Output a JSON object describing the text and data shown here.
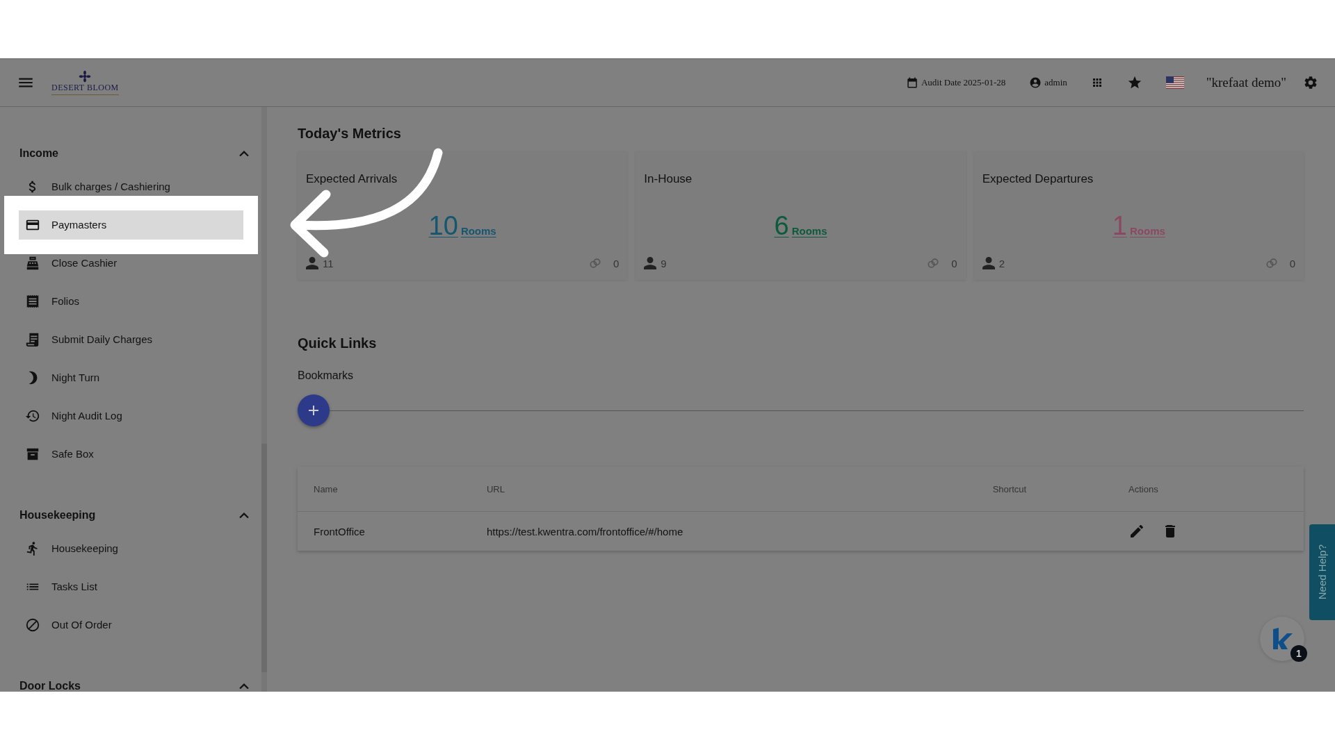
{
  "header": {
    "logo": "DESERT BLOOM",
    "audit_date": "Audit Date 2025-01-28",
    "user": "admin",
    "workspace": "\"krefaat demo\""
  },
  "sidebar": {
    "sections": [
      {
        "title": "Income",
        "expanded": true,
        "items": [
          {
            "label": "Bulk charges / Cashiering",
            "kind": "dollar",
            "selected": false
          },
          {
            "label": "Paymasters",
            "kind": "card",
            "selected": true
          },
          {
            "label": "Close Cashier",
            "kind": "register",
            "selected": false
          },
          {
            "label": "Folios",
            "kind": "receipt",
            "selected": false
          },
          {
            "label": "Submit Daily Charges",
            "kind": "document",
            "selected": false
          },
          {
            "label": "Night Turn",
            "kind": "moon",
            "selected": false
          },
          {
            "label": "Night Audit Log",
            "kind": "history",
            "selected": false
          },
          {
            "label": "Safe Box",
            "kind": "archive",
            "selected": false
          }
        ]
      },
      {
        "title": "Housekeeping",
        "expanded": true,
        "items": [
          {
            "label": "Housekeeping",
            "kind": "runner",
            "selected": false
          },
          {
            "label": "Tasks List",
            "kind": "list",
            "selected": false
          },
          {
            "label": "Out Of Order",
            "kind": "block",
            "selected": false
          }
        ]
      },
      {
        "title": "Door Locks",
        "expanded": true
      }
    ]
  },
  "metrics": {
    "title": "Today's Metrics",
    "cards": [
      {
        "title": "Expected Arrivals",
        "count": "10",
        "unit": "Rooms",
        "color": "#17566f",
        "guests": "11",
        "linked": "0"
      },
      {
        "title": "In-House",
        "count": "6",
        "unit": "Rooms",
        "color": "#0e5a3c",
        "guests": "9",
        "linked": "0"
      },
      {
        "title": "Expected Departures",
        "count": "1",
        "unit": "Rooms",
        "color": "#8a4862",
        "guests": "2",
        "linked": "0"
      }
    ]
  },
  "quick_links": {
    "title": "Quick Links",
    "subtitle": "Bookmarks",
    "columns": [
      "Name",
      "URL",
      "Shortcut",
      "Actions"
    ],
    "rows": [
      {
        "name": "FrontOffice",
        "url": "https://test.kwentra.com/frontoffice/#/home"
      }
    ]
  },
  "help_tab": "Need Help?",
  "chat_badge": "1"
}
